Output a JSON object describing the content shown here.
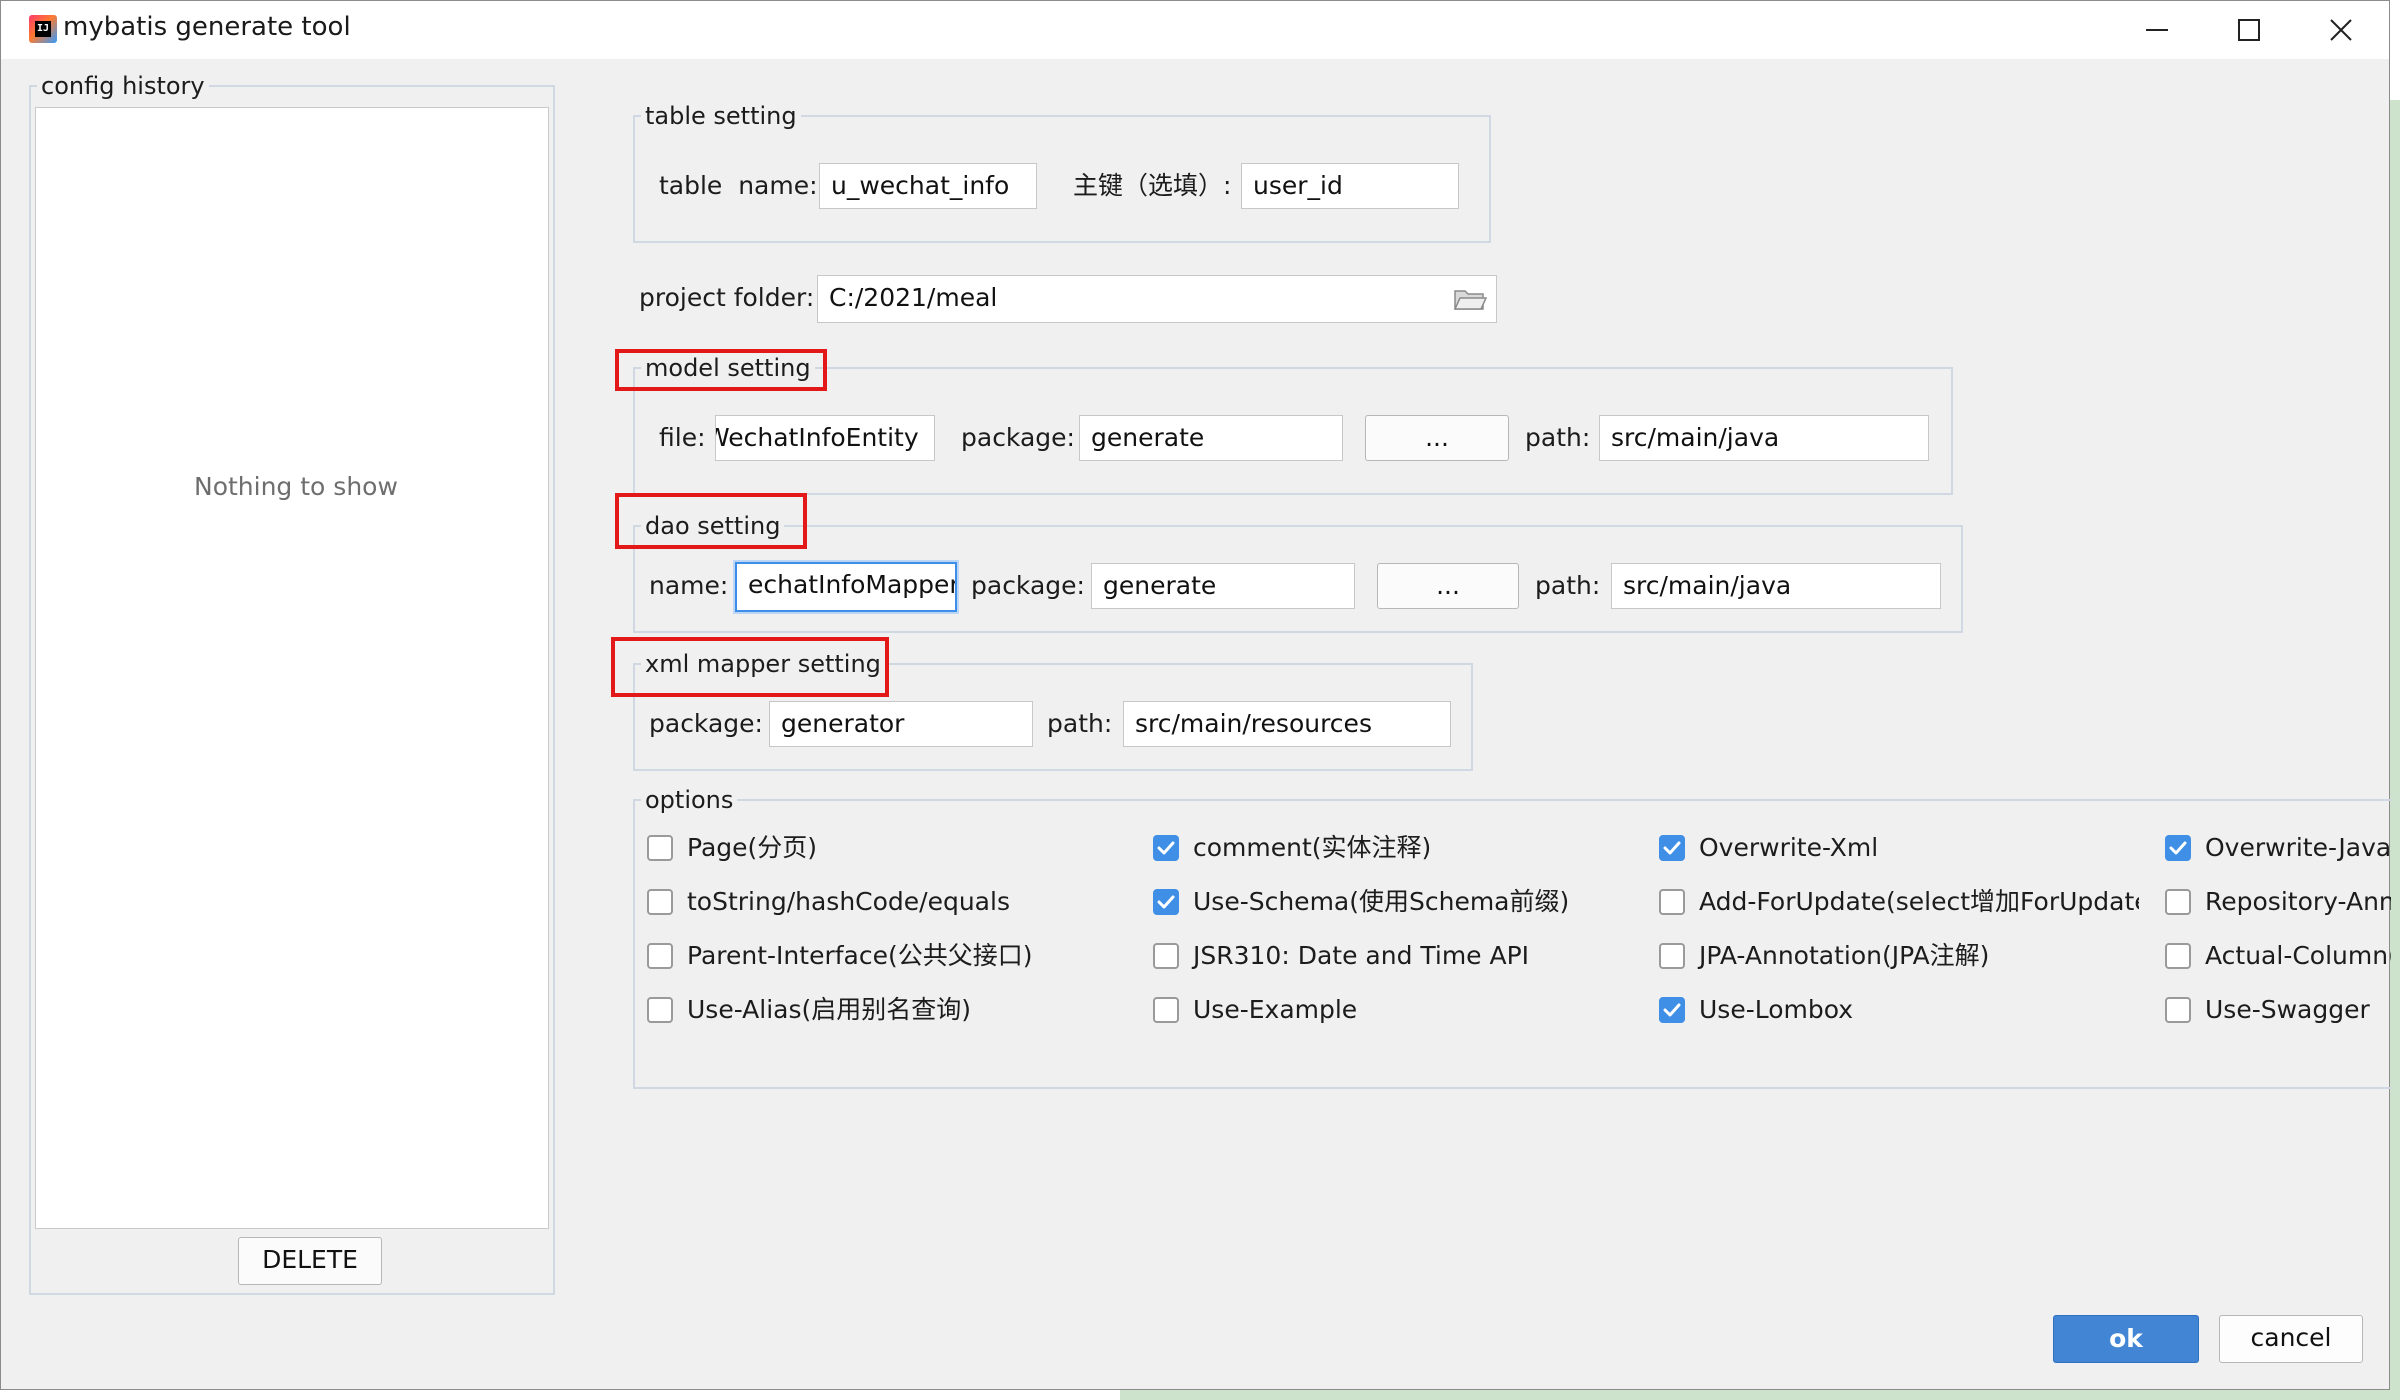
{
  "window": {
    "title": "mybatis generate tool"
  },
  "history": {
    "legend": "config history",
    "empty_text": "Nothing to show",
    "delete_label": "DELETE"
  },
  "table_setting": {
    "legend": "table setting",
    "table_name_label": "table  name:",
    "table_name_value": "u_wechat_info",
    "pk_label": "主键（选填）:",
    "pk_value": "user_id"
  },
  "project": {
    "label": "project folder:",
    "value": "C:/2021/meal"
  },
  "model_setting": {
    "legend": "model setting",
    "file_label": "file:",
    "file_value": "WechatInfoEntity",
    "package_label": "package:",
    "package_value": "generate",
    "browse_label": "...",
    "path_label": "path:",
    "path_value": "src/main/java"
  },
  "dao_setting": {
    "legend": "dao setting",
    "name_label": "name:",
    "name_value": "echatInfoMapper",
    "package_label": "package:",
    "package_value": "generate",
    "browse_label": "...",
    "path_label": "path:",
    "path_value": "src/main/java"
  },
  "xml_setting": {
    "legend": "xml mapper setting",
    "package_label": "package:",
    "package_value": "generator",
    "path_label": "path:",
    "path_value": "src/main/resources"
  },
  "options": {
    "legend": "options",
    "items": [
      {
        "label": "Page(分页)",
        "checked": false
      },
      {
        "label": "comment(实体注释)",
        "checked": true
      },
      {
        "label": "Overwrite-Xml",
        "checked": true
      },
      {
        "label": "Overwrite-Java",
        "checked": true
      },
      {
        "label": "toString/hashCode/equals",
        "checked": false
      },
      {
        "label": "Use-Schema(使用Schema前缀)",
        "checked": true
      },
      {
        "label": "Add-ForUpdate(select增加ForUpdate)",
        "checked": false
      },
      {
        "label": "Repository-Ann",
        "checked": false
      },
      {
        "label": "Parent-Interface(公共父接口)",
        "checked": false
      },
      {
        "label": "JSR310: Date and Time API",
        "checked": false
      },
      {
        "label": "JPA-Annotation(JPA注解)",
        "checked": false
      },
      {
        "label": "Actual-Column(",
        "checked": false
      },
      {
        "label": "Use-Alias(启用别名查询)",
        "checked": false
      },
      {
        "label": "Use-Example",
        "checked": false
      },
      {
        "label": "Use-Lombox",
        "checked": true
      },
      {
        "label": "Use-Swagger",
        "checked": false
      }
    ]
  },
  "footer": {
    "ok_label": "ok",
    "cancel_label": "cancel"
  },
  "colors": {
    "accent": "#3f8fe6",
    "highlight_box": "#e31818",
    "ok_button": "#4285d4"
  },
  "icons": {
    "folder": "folder-open-icon",
    "minimize": "minimize-icon",
    "maximize": "maximize-icon",
    "close": "close-icon",
    "check": "check-icon"
  }
}
